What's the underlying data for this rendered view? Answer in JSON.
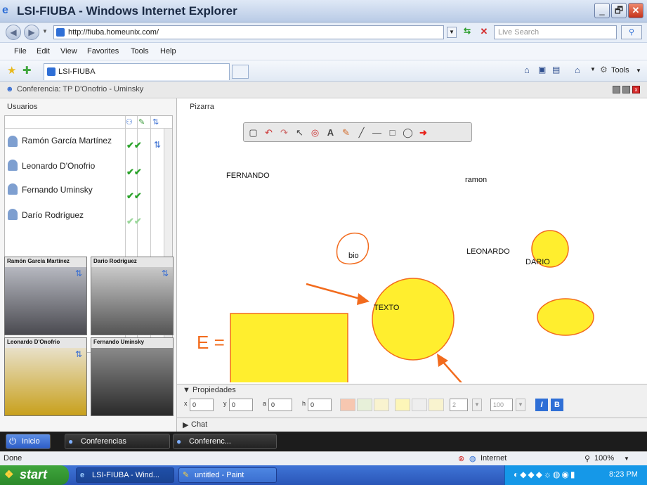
{
  "window": {
    "title": "LSI-FIUBA - Windows Internet Explorer",
    "buttons": [
      "_",
      "🗗",
      "✕"
    ]
  },
  "address": {
    "url": "http://fiuba.homeunix.com/",
    "search_placeholder": "Live Search"
  },
  "menu": {
    "items": [
      "File",
      "Edit",
      "View",
      "Favorites",
      "Tools",
      "Help"
    ]
  },
  "favbar": {
    "tab_label": "LSI-FIUBA",
    "tools_label": "Tools"
  },
  "app": {
    "title": "Conferencia: TP D'Onofrio - Uminsky",
    "users_label": "Usuarios",
    "board_label": "Pizarra",
    "users": [
      {
        "name": "Ramón García Martínez",
        "checks": "✔✔",
        "extra": "⇅"
      },
      {
        "name": "Leonardo D'Onofrio",
        "checks": "✔✔",
        "extra": ""
      },
      {
        "name": "Fernando Uminsky",
        "checks": "✔✔",
        "extra": ""
      },
      {
        "name": "Darío Rodríguez",
        "checks": "✔✔",
        "extra": ""
      }
    ],
    "videos": [
      {
        "label": "Ramón García Martínez"
      },
      {
        "label": "Dario Rodríguez"
      },
      {
        "label": "Leonardo D'Onofrio"
      },
      {
        "label": "Fernando Uminsky"
      }
    ],
    "board_texts": {
      "fernando": "FERNANDO",
      "ramon": "ramon",
      "leonardo": "LEONARDO",
      "dario": "DARIO",
      "texto": "TEXTO",
      "bio": "bio",
      "e_eq": "E ="
    },
    "properties": {
      "title": "Propiedades",
      "x_label": "x",
      "x_value": "0",
      "y_label": "y",
      "y_value": "0",
      "a_label": "a",
      "a_value": "0",
      "h_label": "h",
      "h_value": "0",
      "line_width": "2",
      "opacity": "100",
      "italic": "I",
      "bold": "B"
    },
    "chat_label": "Chat",
    "bottom_tabs": [
      "Inicio",
      "Conferencias",
      "Conferenc..."
    ]
  },
  "colors": {
    "yellow": "#FFEE2E",
    "orange": "#F26B1D",
    "blue_fill": "#1531D8",
    "red": "#E8231B",
    "accent_blue": "#2f6fd6"
  },
  "status": {
    "text": "Done",
    "zone": "Internet",
    "zoom": "100%"
  },
  "taskbar": {
    "start": "start",
    "tasks": [
      "LSI-FIUBA - Wind...",
      "untitled - Paint"
    ],
    "time": "8:23 PM"
  }
}
